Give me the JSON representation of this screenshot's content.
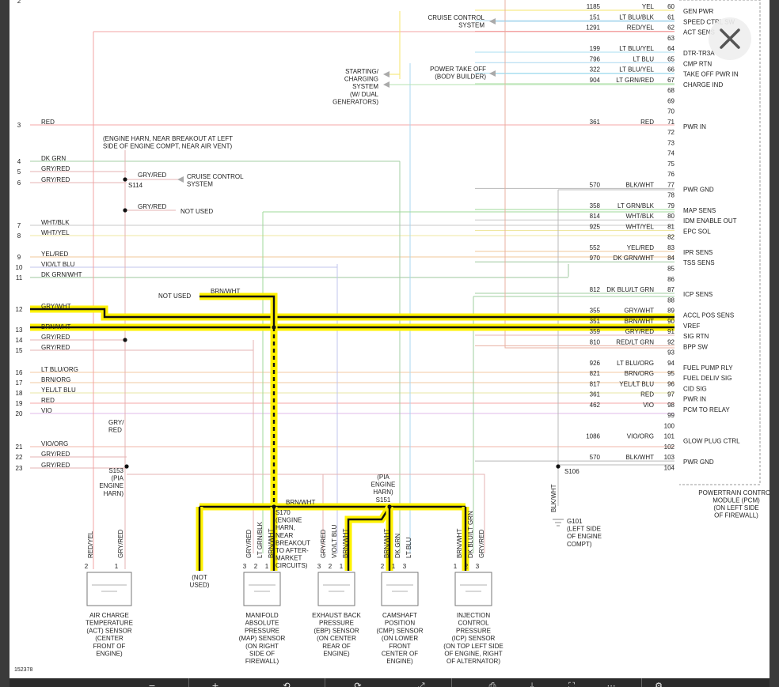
{
  "viewer": {
    "close_label": "Close",
    "close_icon": "close-icon"
  },
  "diagram": {
    "figure_id": "152378",
    "pcm_label": [
      "POWERTRAIN CONTROL",
      "MODULE (PCM)",
      "(ON LEFT SIDE",
      "OF FIREWALL)"
    ],
    "pcm_pins": [
      {
        "pin": "60",
        "circuit": "1185",
        "color": "YEL",
        "func": "GEN PWR"
      },
      {
        "pin": "61",
        "circuit": "151",
        "color": "LT BLU/BLK",
        "func": "SPEED CTRL SW"
      },
      {
        "pin": "62",
        "circuit": "1291",
        "color": "RED/YEL",
        "func": "ACT SENS"
      },
      {
        "pin": "63",
        "circuit": "",
        "color": "",
        "func": ""
      },
      {
        "pin": "64",
        "circuit": "199",
        "color": "LT BLU/YEL",
        "func": "DTR-TR3A"
      },
      {
        "pin": "65",
        "circuit": "796",
        "color": "LT BLU",
        "func": "CMP RTN"
      },
      {
        "pin": "66",
        "circuit": "322",
        "color": "LT BLU/YEL",
        "func": "TAKE OFF PWR IN"
      },
      {
        "pin": "67",
        "circuit": "904",
        "color": "LT GRN/RED",
        "func": "CHARGE IND"
      },
      {
        "pin": "68",
        "circuit": "",
        "color": "",
        "func": ""
      },
      {
        "pin": "69",
        "circuit": "",
        "color": "",
        "func": ""
      },
      {
        "pin": "70",
        "circuit": "",
        "color": "",
        "func": ""
      },
      {
        "pin": "71",
        "circuit": "361",
        "color": "RED",
        "func": "PWR IN"
      },
      {
        "pin": "72",
        "circuit": "",
        "color": "",
        "func": ""
      },
      {
        "pin": "73",
        "circuit": "",
        "color": "",
        "func": ""
      },
      {
        "pin": "74",
        "circuit": "",
        "color": "",
        "func": ""
      },
      {
        "pin": "75",
        "circuit": "",
        "color": "",
        "func": ""
      },
      {
        "pin": "76",
        "circuit": "",
        "color": "",
        "func": ""
      },
      {
        "pin": "77",
        "circuit": "570",
        "color": "BLK/WHT",
        "func": "PWR GND"
      },
      {
        "pin": "78",
        "circuit": "",
        "color": "",
        "func": ""
      },
      {
        "pin": "79",
        "circuit": "358",
        "color": "LT GRN/BLK",
        "func": "MAP SENS"
      },
      {
        "pin": "80",
        "circuit": "814",
        "color": "WHT/BLK",
        "func": "IDM ENABLE OUT"
      },
      {
        "pin": "81",
        "circuit": "925",
        "color": "WHT/YEL",
        "func": "EPC SOL"
      },
      {
        "pin": "82",
        "circuit": "",
        "color": "",
        "func": ""
      },
      {
        "pin": "83",
        "circuit": "552",
        "color": "YEL/RED",
        "func": "IPR SENS"
      },
      {
        "pin": "84",
        "circuit": "970",
        "color": "DK GRN/WHT",
        "func": "TSS SENS"
      },
      {
        "pin": "85",
        "circuit": "",
        "color": "",
        "func": ""
      },
      {
        "pin": "86",
        "circuit": "",
        "color": "",
        "func": ""
      },
      {
        "pin": "87",
        "circuit": "812",
        "color": "DK BLU/LT GRN",
        "func": "ICP SENS"
      },
      {
        "pin": "88",
        "circuit": "",
        "color": "",
        "func": ""
      },
      {
        "pin": "89",
        "circuit": "355",
        "color": "GRY/WHT",
        "func": "ACCL POS SENS"
      },
      {
        "pin": "90",
        "circuit": "351",
        "color": "BRN/WHT",
        "func": "VREF"
      },
      {
        "pin": "91",
        "circuit": "359",
        "color": "GRY/RED",
        "func": "SIG RTN"
      },
      {
        "pin": "92",
        "circuit": "810",
        "color": "RED/LT GRN",
        "func": "BPP SW"
      },
      {
        "pin": "93",
        "circuit": "",
        "color": "",
        "func": ""
      },
      {
        "pin": "94",
        "circuit": "926",
        "color": "LT BLU/ORG",
        "func": "FUEL PUMP RLY"
      },
      {
        "pin": "95",
        "circuit": "821",
        "color": "BRN/ORG",
        "func": "FUEL DELIV SIG"
      },
      {
        "pin": "96",
        "circuit": "817",
        "color": "YEL/LT BLU",
        "func": "CID SIG"
      },
      {
        "pin": "97",
        "circuit": "361",
        "color": "RED",
        "func": "PWR IN"
      },
      {
        "pin": "98",
        "circuit": "462",
        "color": "VIO",
        "func": "PCM TO RELAY"
      },
      {
        "pin": "99",
        "circuit": "",
        "color": "",
        "func": ""
      },
      {
        "pin": "100",
        "circuit": "",
        "color": "",
        "func": ""
      },
      {
        "pin": "101",
        "circuit": "1086",
        "color": "VIO/ORG",
        "func": "GLOW PLUG CTRL"
      },
      {
        "pin": "102",
        "circuit": "",
        "color": "",
        "func": ""
      },
      {
        "pin": "103",
        "circuit": "570",
        "color": "BLK/WHT",
        "func": "PWR GND"
      },
      {
        "pin": "104",
        "circuit": "",
        "color": "",
        "func": ""
      }
    ],
    "left_wires": [
      {
        "num": "2",
        "label": ""
      },
      {
        "num": "3",
        "label": "RED"
      },
      {
        "num": "4",
        "label": "DK GRN"
      },
      {
        "num": "5",
        "label": "GRY/RED"
      },
      {
        "num": "6",
        "label": "GRY/RED"
      },
      {
        "num": "7",
        "label": "WHT/BLK"
      },
      {
        "num": "8",
        "label": "WHT/YEL"
      },
      {
        "num": "9",
        "label": "YEL/RED"
      },
      {
        "num": "10",
        "label": "VIO/LT BLU"
      },
      {
        "num": "11",
        "label": "DK GRN/WHT"
      },
      {
        "num": "12",
        "label": "GRY/WHT"
      },
      {
        "num": "13",
        "label": "BRN/WHT"
      },
      {
        "num": "14",
        "label": "GRY/RED"
      },
      {
        "num": "15",
        "label": "GRY/RED"
      },
      {
        "num": "16",
        "label": "LT BLU/ORG"
      },
      {
        "num": "17",
        "label": "BRN/ORG"
      },
      {
        "num": "18",
        "label": "YEL/LT BLU"
      },
      {
        "num": "19",
        "label": "RED"
      },
      {
        "num": "20",
        "label": "VIO"
      },
      {
        "num": "21",
        "label": "VIO/ORG"
      },
      {
        "num": "22",
        "label": "GRY/RED"
      },
      {
        "num": "23",
        "label": "GRY/RED"
      }
    ],
    "right_wires_top": [
      {
        "circuit": "1185",
        "color": "YEL",
        "pin": "60"
      },
      {
        "circuit": "151",
        "color": "LT BLU/BLK",
        "pin": "61"
      },
      {
        "circuit": "1291",
        "color": "RED/YEL",
        "pin": "62"
      }
    ],
    "misc": {
      "cruise_top": [
        "CRUISE CONTROL",
        "SYSTEM"
      ],
      "pto": [
        "POWER TAKE OFF",
        "(BODY BUILDER)"
      ],
      "starting": [
        "STARTING/",
        "CHARGING",
        "SYSTEM",
        "(W/ DUAL",
        "GENERATORS)"
      ],
      "engine_harn_note": [
        "(ENGINE HARN, NEAR BREAKOUT AT LEFT",
        "SIDE OF ENGINE COMPT, NEAR AIR VENT)"
      ],
      "s114": "S114",
      "cruise_mid": [
        "CRUISE CONTROL",
        "SYSTEM"
      ],
      "gry_red": "GRY/RED",
      "not_used": "NOT USED",
      "not_used_top": "NOT USED",
      "brn_wht": "BRN/WHT",
      "s153": [
        "S153",
        "(PIA",
        "ENGINE",
        "HARN)"
      ],
      "gry_red_split": [
        "GRY/",
        "RED"
      ],
      "s170": [
        "S170",
        "(ENGINE",
        "HARN,",
        "NEAR",
        "BREAKOUT",
        "TO AFTER-",
        "MARKET",
        "CIRCUITS)"
      ],
      "s151": [
        "(PIA",
        "ENGINE",
        "HARN)",
        "S151"
      ],
      "s106": "S106",
      "blk_wht": "BLK/WHT",
      "g101": [
        "G101",
        "(LEFT SIDE",
        "OF ENGINE",
        "COMPT)"
      ],
      "not_used_bottom": [
        "(NOT",
        "USED)"
      ]
    },
    "sensors": [
      {
        "id": "act",
        "wires": [
          "RED/YEL",
          "GRY/RED"
        ],
        "pins": [
          "2",
          "1"
        ],
        "label": [
          "AIR CHARGE",
          "TEMPERATURE",
          "(ACT) SENSOR",
          "(CENTER",
          "FRONT OF",
          "ENGINE)"
        ]
      },
      {
        "id": "map",
        "wires": [
          "GRY/RED",
          "LT GRN/BLK",
          "BRN/WHT"
        ],
        "pins": [
          "3",
          "2",
          "1"
        ],
        "label": [
          "MANIFOLD",
          "ABSOLUTE",
          "PRESSURE",
          "(MAP) SENSOR",
          "(ON RIGHT",
          "SIDE OF",
          "FIREWALL)"
        ]
      },
      {
        "id": "ebp",
        "wires": [
          "GRY/RED",
          "VIO/LT BLU",
          "BRN/WHT"
        ],
        "pins": [
          "3",
          "2",
          "1"
        ],
        "label": [
          "EXHAUST BACK",
          "PRESSURE",
          "(EBP) SENSOR",
          "(ON CENTER",
          "REAR OF",
          "ENGINE)"
        ]
      },
      {
        "id": "cmp",
        "wires": [
          "BRN/WHT",
          "DK GRN",
          "LT BLU"
        ],
        "pins": [
          "2",
          "1",
          "3"
        ],
        "label": [
          "CAMSHAFT",
          "POSITION",
          "(CMP) SENSOR",
          "(ON LOWER",
          "FRONT",
          "CENTER OF",
          "ENGINE)"
        ]
      },
      {
        "id": "icp",
        "wires": [
          "BRN/WHT",
          "DK BLU/LT GRN",
          "GRY/RED"
        ],
        "pins": [
          "1",
          "2",
          "3"
        ],
        "label": [
          "INJECTION",
          "CONTROL",
          "PRESSURE",
          "(ICP) SENSOR",
          "(ON TOP LEFT SIDE",
          "OF ENGINE, RIGHT",
          "OF ALTERNATOR)"
        ]
      }
    ]
  },
  "toolbar": {
    "buttons": [
      "zoom-out-icon",
      "zoom-in-icon",
      "previous-icon",
      "next-icon",
      "fit-icon",
      "print-icon",
      "download-icon",
      "fullscreen-icon",
      "more-icon",
      "settings-icon"
    ]
  }
}
